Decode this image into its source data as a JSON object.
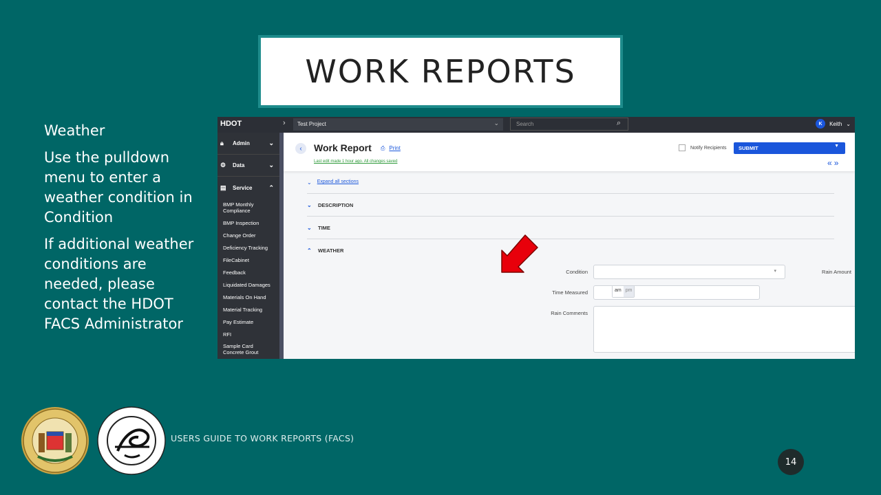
{
  "slide": {
    "title": "WORK REPORTS",
    "paragraphs": [
      "Weather",
      "Use the pulldown menu to enter a weather condition in Condition",
      "If additional weather conditions are needed, please contact the HDOT FACS Administrator"
    ],
    "footer": "USERS GUIDE TO WORK REPORTS  (FACS)",
    "page_number": "14",
    "colors": {
      "background": "#006666",
      "title_border": "#1e8c8c",
      "arrow": "#e8000b"
    }
  },
  "app": {
    "brand": "HDOT",
    "project": "Test Project",
    "search_placeholder": "Search",
    "user": {
      "initial": "K",
      "name": "Keith"
    },
    "sidebar": {
      "sections": [
        {
          "label": "Admin",
          "icon": "lock-icon"
        },
        {
          "label": "Data",
          "icon": "gears-icon"
        },
        {
          "label": "Service",
          "icon": "clipboard-icon"
        }
      ],
      "items": [
        "BMP Monthly Compliance",
        "BMP Inspection",
        "Change Order",
        "Deficiency Tracking",
        "FileCabinet",
        "Feedback",
        "Liquidated Damages",
        "Materials On Hand",
        "Material Tracking",
        "Pay Estimate",
        "RFI",
        "Sample Card Concrete Grout"
      ]
    },
    "header": {
      "title": "Work Report",
      "print_label": "Print",
      "last_edit": "Last edit made 1 hour ago. All changes saved",
      "notify_label": "Notify Recipients",
      "submit_label": "SUBMIT"
    },
    "expand_all": "Expand all sections",
    "sections": [
      "DESCRIPTION",
      "TIME",
      "WEATHER"
    ],
    "weather": {
      "condition_label": "Condition",
      "condition_value": "",
      "rain_amount_label": "Rain Amount",
      "rain_amount_value": "",
      "time_measured_label": "Time Measured",
      "time_measured_value": "",
      "am_label": "am",
      "pm_label": "pm",
      "rain_comments_label": "Rain Comments",
      "rain_comments_value": ""
    }
  }
}
